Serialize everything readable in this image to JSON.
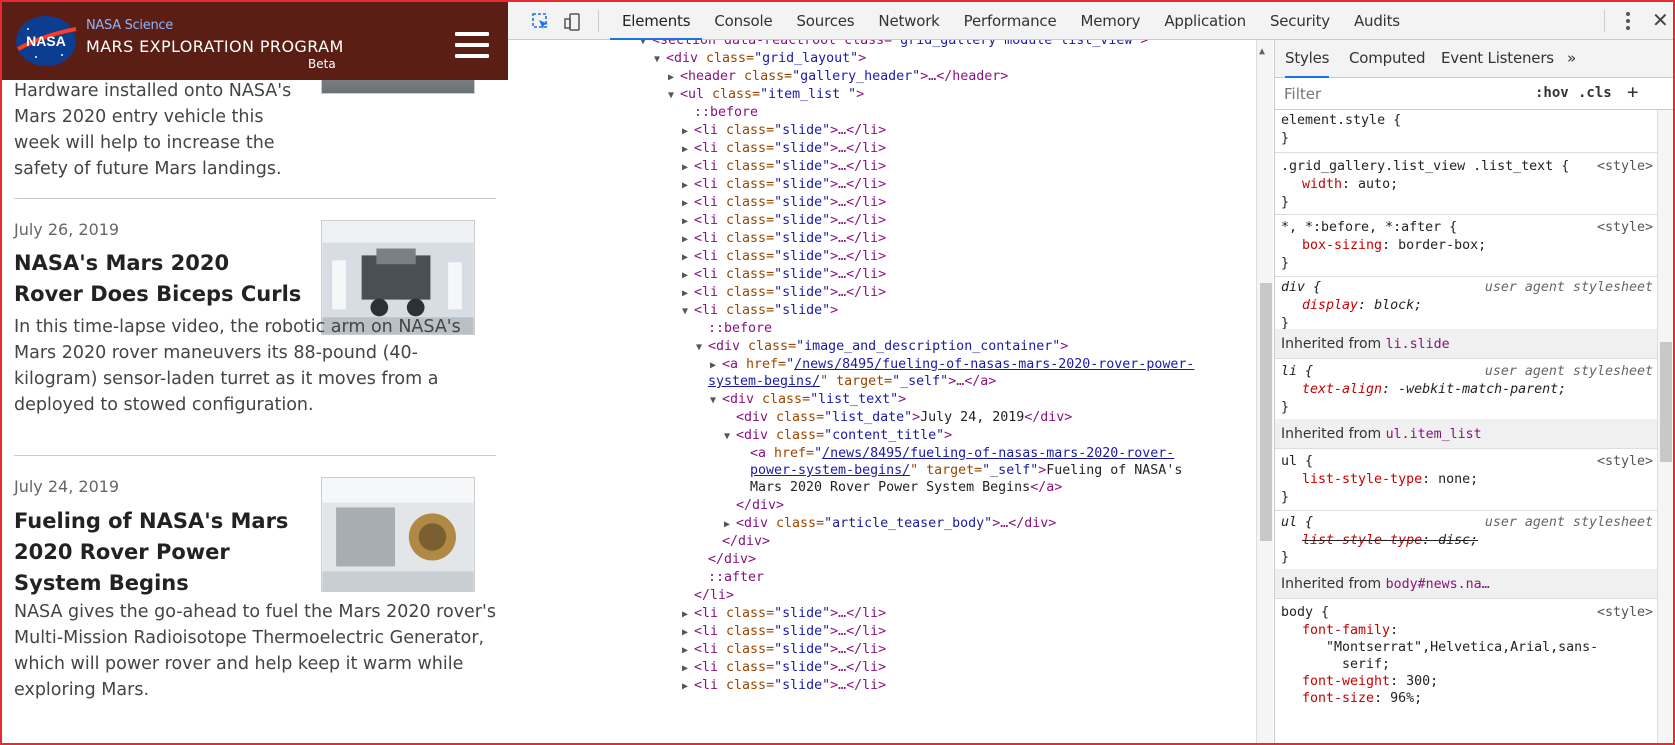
{
  "site": {
    "brand_small": "NASA Science",
    "brand_title": "MARS EXPLORATION PROGRAM",
    "brand_beta": "Beta",
    "logo_text": "NASA",
    "articles": [
      {
        "date": "",
        "title": "",
        "teaser": "Hardware installed onto NASA's Mars 2020 entry vehicle this week will help to increase the safety of future Mars landings."
      },
      {
        "date": "July 26, 2019",
        "title": "NASA's Mars 2020 Rover Does Biceps Curls",
        "teaser": "In this time-lapse video, the robotic arm on NASA's Mars 2020 rover maneuvers its 88-pound (40-kilogram) sensor-laden turret as it moves from a deployed to stowed configuration."
      },
      {
        "date": "July 24, 2019",
        "title": "Fueling of NASA's Mars 2020 Rover Power System Begins",
        "teaser": "NASA gives the go-ahead to fuel the Mars 2020 rover's Multi-Mission Radioisotope Thermoelectric Generator, which will power rover and help keep it warm while exploring Mars."
      }
    ]
  },
  "devtools": {
    "tabs": [
      "Elements",
      "Console",
      "Sources",
      "Network",
      "Performance",
      "Memory",
      "Application",
      "Security",
      "Audits"
    ],
    "active_tab": "Elements",
    "close": "✕",
    "styles_tabs": [
      "Styles",
      "Computed",
      "Event Listeners",
      "»"
    ],
    "filter_placeholder": "Filter",
    "hov": ":hov",
    "cls": ".cls",
    "plus": "+",
    "dom": {
      "l0": {
        "a": "<section data-reactroot class=",
        "b": "\"grid_gallery module list_view\"",
        "c": ">"
      },
      "l1": {
        "a": "<div",
        "b": " class=",
        "c": "\"grid_layout\"",
        "d": ">"
      },
      "l2": {
        "a": "<header",
        "b": " class=",
        "c": "\"gallery_header\"",
        "d": ">…</header>"
      },
      "l3": {
        "a": "<ul",
        "b": " class=",
        "c": "\"item_list \"",
        "d": ">"
      },
      "before": "::before",
      "after": "::after",
      "slide": {
        "a": "<li",
        "b": " class=",
        "c": "\"slide\"",
        "d": ">…</li>"
      },
      "slide_open": {
        "a": "<li",
        "b": " class=",
        "c": "\"slide\"",
        "d": ">"
      },
      "idc": {
        "a": "<div",
        "b": " class=",
        "c": "\"image_and_description_container\"",
        "d": ">"
      },
      "a1": {
        "a": "<a",
        "b": " href=",
        "q": "\"",
        "link1": "/news/8495/fueling-of-nasas-mars-2020-rover-power-",
        "link2": "system-begins/",
        "c": "\" target=",
        "d": "\"_self\"",
        "e": ">…</a>"
      },
      "lt": {
        "a": "<div",
        "b": " class=",
        "c": "\"list_text\"",
        "d": ">"
      },
      "ld": {
        "a": "<div",
        "b": " class=",
        "c": "\"list_date\"",
        "d": ">",
        "t": "July 24, 2019",
        "e": "</div>"
      },
      "ct": {
        "a": "<div",
        "b": " class=",
        "c": "\"content_title\"",
        "d": ">"
      },
      "a2": {
        "a": "<a",
        "b": " href=",
        "q": "\"",
        "link1": "/news/8495/fueling-of-nasas-mars-2020-rover-",
        "link2": "power-system-begins/",
        "c": "\" target=",
        "d": "\"_self\"",
        "e": ">",
        "t1": "Fueling of NASA's",
        "t2": "Mars 2020 Rover Power System Begins",
        "f": "</a>"
      },
      "enddiv": "</div>",
      "atb": {
        "a": "<div",
        "b": " class=",
        "c": "\"article_teaser_body\"",
        "d": ">…</div>"
      },
      "endli": "</li>"
    },
    "styles": {
      "element_style": "element.style {",
      "close_brace": "}",
      "r1_sel": ".grid_gallery.list_view .list_text {",
      "r1_src": "<style>",
      "r1_prop": "width",
      "r1_val": "auto;",
      "r2_sel": "*, *:before, *:after {",
      "r2_src": "<style>",
      "r2_prop": "box-sizing",
      "r2_val": "border-box;",
      "r3_sel": "div {",
      "r3_src": "user agent stylesheet",
      "r3_prop": "display",
      "r3_val": "block;",
      "inh1_label": "Inherited from",
      "inh1_from": "li.slide",
      "r4_sel": "li {",
      "r4_src": "user agent stylesheet",
      "r4_prop": "text-align",
      "r4_val": "-webkit-match-parent;",
      "inh2_label": "Inherited from",
      "inh2_from": "ul.item_list",
      "r5_sel": "ul {",
      "r5_src": "<style>",
      "r5_prop": "list-style-type",
      "r5_val": "none;",
      "r6_sel": "ul {",
      "r6_src": "user agent stylesheet",
      "r6_prop": "list-style-type",
      "r6_val": "disc;",
      "inh3_label": "Inherited from",
      "inh3_from": "body#news.na…",
      "r7_sel": "body {",
      "r7_src": "<style>",
      "r7_prop1": "font-family",
      "r7_val1a": "\"Montserrat\",Helvetica,Arial,sans-",
      "r7_val1b": "serif;",
      "r7_prop2": "font-weight",
      "r7_val2": "300;",
      "r7_prop3": "font-size",
      "r7_val3": "96%;"
    }
  }
}
